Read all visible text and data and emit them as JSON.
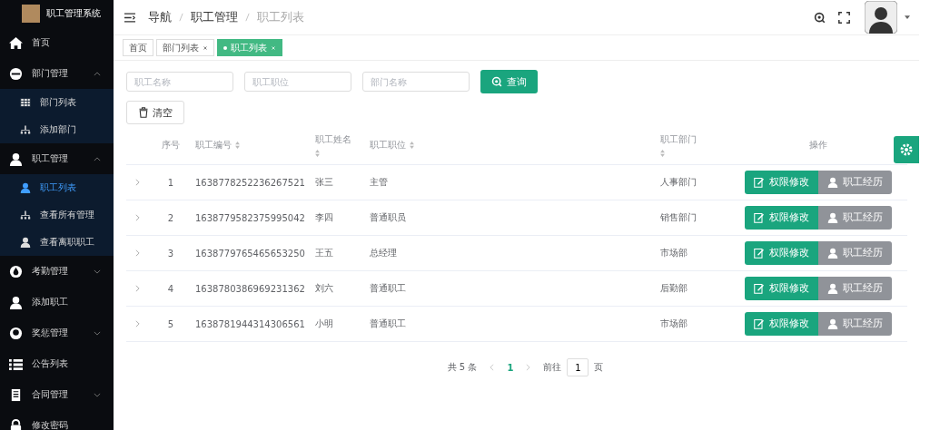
{
  "app": {
    "title": "职工管理系统"
  },
  "sidebar": {
    "items": [
      {
        "kind": "item",
        "label": "首页",
        "selected": false
      },
      {
        "kind": "group",
        "label": "部门管理",
        "expanded": true,
        "children": [
          {
            "label": "部门列表",
            "selected": false
          },
          {
            "label": "添加部门",
            "selected": false
          }
        ]
      },
      {
        "kind": "group",
        "label": "职工管理",
        "expanded": true,
        "children": [
          {
            "label": "职工列表",
            "selected": true
          },
          {
            "label": "查看所有管理",
            "selected": false
          },
          {
            "label": "查看离职职工",
            "selected": false
          }
        ]
      },
      {
        "kind": "group",
        "label": "考勤管理",
        "expanded": false
      },
      {
        "kind": "item",
        "label": "添加职工",
        "selected": false
      },
      {
        "kind": "group",
        "label": "奖惩管理",
        "expanded": false
      },
      {
        "kind": "item",
        "label": "公告列表",
        "selected": false
      },
      {
        "kind": "group",
        "label": "合同管理",
        "expanded": false
      },
      {
        "kind": "item",
        "label": "修改密码",
        "selected": false
      }
    ]
  },
  "breadcrumb": [
    "导航",
    "职工管理",
    "职工列表"
  ],
  "tabs": [
    {
      "label": "首页",
      "closable": false,
      "selected": false
    },
    {
      "label": "部门列表",
      "closable": true,
      "selected": false
    },
    {
      "label": "职工列表",
      "closable": true,
      "selected": true
    }
  ],
  "filters": {
    "fields": [
      {
        "placeholder": "职工名称"
      },
      {
        "placeholder": "职工职位"
      },
      {
        "placeholder": "部门名称"
      }
    ],
    "search_button": "查询",
    "clear_button": "清空"
  },
  "table": {
    "columns": [
      {
        "label": "序号",
        "sortable": false
      },
      {
        "label": "职工编号",
        "sortable": true
      },
      {
        "label": "职工姓名",
        "sortable": true
      },
      {
        "label": "职工职位",
        "sortable": true
      },
      {
        "label": "职工部门",
        "sortable": true
      },
      {
        "label": "操作",
        "sortable": false
      }
    ],
    "rows": [
      {
        "index": "1",
        "id": "1638778252236267521",
        "name": "张三",
        "position": "主管",
        "department": "人事部门",
        "actions": [
          "权限修改",
          "职工经历"
        ]
      },
      {
        "index": "2",
        "id": "1638779582375995042",
        "name": "李四",
        "position": "普通职员",
        "department": "销售部门",
        "actions": [
          "权限修改",
          "职工经历"
        ]
      },
      {
        "index": "3",
        "id": "1638779765465653250",
        "name": "王五",
        "position": "总经理",
        "department": "市场部",
        "actions": [
          "权限修改",
          "职工经历"
        ]
      },
      {
        "index": "4",
        "id": "1638780386969231362",
        "name": "刘六",
        "position": "普通职工",
        "department": "后勤部",
        "actions": [
          "权限修改",
          "职工经历"
        ]
      },
      {
        "index": "5",
        "id": "1638781944314306561",
        "name": "小明",
        "position": "普通职工",
        "department": "市场部",
        "actions": [
          "权限修改",
          "职工经历"
        ]
      }
    ]
  },
  "pagination": {
    "total": "共 5 条",
    "pages": [
      {
        "label": "1",
        "selected": true
      }
    ],
    "goto_label": "前往",
    "goto_value": "1",
    "page_suffix": "页"
  }
}
